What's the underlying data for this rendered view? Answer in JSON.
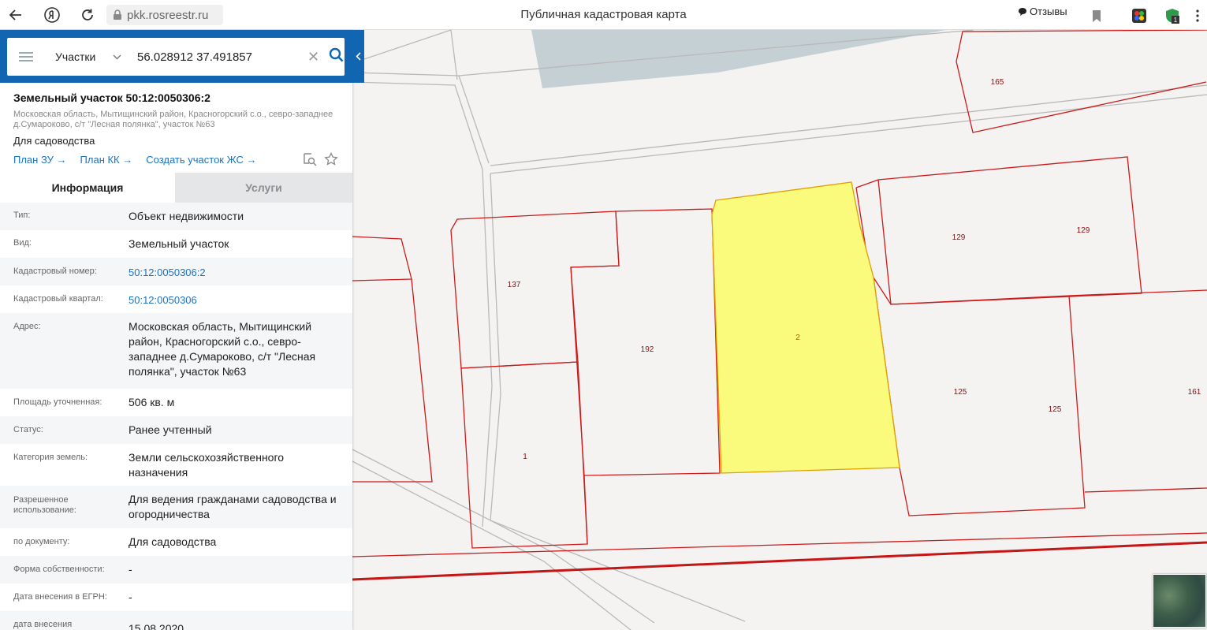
{
  "browser": {
    "domain": "pkk.rosreestr.ru",
    "title": "Публичная кадастровая карта",
    "reviews_label": "Отзывы"
  },
  "search": {
    "type": "Участки",
    "query": "56.028912 37.491857"
  },
  "object": {
    "title": "Земельный участок 50:12:0050306:2",
    "address": "Московская область, Мытищинский район, Красногорский с.о., севро-западнее д.Сумароково, с/т \"Лесная полянка\", участок №63",
    "purpose": "Для садоводства",
    "links": [
      "План ЗУ →",
      "План КК →",
      "Создать участок ЖС →"
    ]
  },
  "tabs": {
    "info": "Информация",
    "services": "Услуги"
  },
  "info_rows": [
    {
      "label": "Тип:",
      "value": "Объект недвижимости"
    },
    {
      "label": "Вид:",
      "value": "Земельный участок"
    },
    {
      "label": "Кадастровый номер:",
      "value": "50:12:0050306:2"
    },
    {
      "label": "Кадастровый квартал:",
      "value": "50:12:0050306"
    },
    {
      "label": "Адрес:",
      "value": "Московская область, Мытищинский район, Красногорский с.о., севро-западнее д.Сумароково, с/т \"Лесная полянка\", участок №63"
    },
    {
      "label": "Площадь уточненная:",
      "value": "506 кв. м"
    },
    {
      "label": "Статус:",
      "value": "Ранее учтенный"
    },
    {
      "label": "Категория земель:",
      "value": "Земли сельскохозяйственного назначения"
    },
    {
      "label": "Разрешенное использование:",
      "value": "Для ведения гражданами садоводства и огородничества"
    },
    {
      "label": "по документу:",
      "value": "Для садоводства"
    },
    {
      "label": "Форма собственности:",
      "value": "-"
    },
    {
      "label": "Дата внесения в ЕГРН:",
      "value": "-"
    },
    {
      "label": "дата внесения",
      "value": "15.08.2020"
    }
  ],
  "map": {
    "parcel_labels": [
      "165",
      "129",
      "129",
      "137",
      "2",
      "192",
      "125",
      "125",
      "161",
      "1"
    ],
    "colors": {
      "selected_fill": "#fafa7c",
      "selected_stroke": "#e0a000",
      "parcel_stroke": "#cc1a1a",
      "road_stroke": "#b9b9b9",
      "water": "#c5d0d4"
    }
  }
}
